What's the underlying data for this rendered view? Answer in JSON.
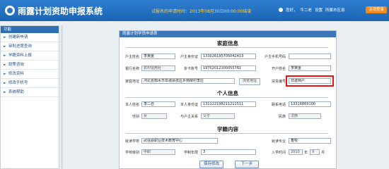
{
  "header": {
    "title": "雨露计划资助申报系统",
    "notice": "试报名的申请时间：2013年08月30日00:00:00结束",
    "user_greeting": "您好，",
    "user_name": "牛二老",
    "profile_link": "设置",
    "help_link": "所属市区县",
    "logout": "注销登录"
  },
  "sidebar": {
    "heading": "功能",
    "items": [
      {
        "label": "创建新申请"
      },
      {
        "label": "审批进度查询"
      },
      {
        "label": "学籍资料上报"
      },
      {
        "label": "政策咨询"
      },
      {
        "label": "修改资料"
      },
      {
        "label": "修改手机号"
      },
      {
        "label": "系统帮助"
      }
    ]
  },
  "form": {
    "panel_title": "雨露计划学员申请表",
    "family_section": "家庭信息",
    "family": {
      "hh_name_label": "户主姓名",
      "hh_name": "李爽金",
      "hh_id_label": "户主身份证",
      "hh_id": "133026195705042413",
      "hh_phone_label": "户主手机号码",
      "hh_phone": "",
      "bank_label": "银行名称",
      "bank": "农村信用社",
      "card_label": "折卡账号",
      "card": "19702012100055781",
      "account_name_label": "开户姓名",
      "account_name": "李爽金",
      "address_label": "家庭地址",
      "address": "河北省衡水市阜城县抚庄乡南柳村李庄",
      "address_button": "浏览地址",
      "verify_label": "扶贫编号",
      "verify": "非建档户"
    },
    "personal_section": "个人信息",
    "personal": {
      "name_label": "本人姓名",
      "name": "李二召",
      "id_label": "本人身份证",
      "id": "131122198211211511",
      "phone_label": "联系电话",
      "phone": "13316869100",
      "gender_label": "性别",
      "gender": "女",
      "relation_label": "与户主关系",
      "relation": "父子",
      "ethnicity_label": "民族",
      "ethnicity": "汉族"
    },
    "school_section": "学籍内容",
    "school": {
      "school_label": "就读学校",
      "school": "武强县职业技术教育中心",
      "major_label": "就读专业",
      "major": "畜牧",
      "level_label": "学校级别",
      "level": "中职",
      "system_label": "学制年限",
      "system": "3",
      "entry_label": "入学时间",
      "entry_year": "2010",
      "year_unit": "年",
      "entry_month": "9",
      "month_unit": "月"
    },
    "save_button": "保存修改",
    "next_button": "下一步"
  }
}
